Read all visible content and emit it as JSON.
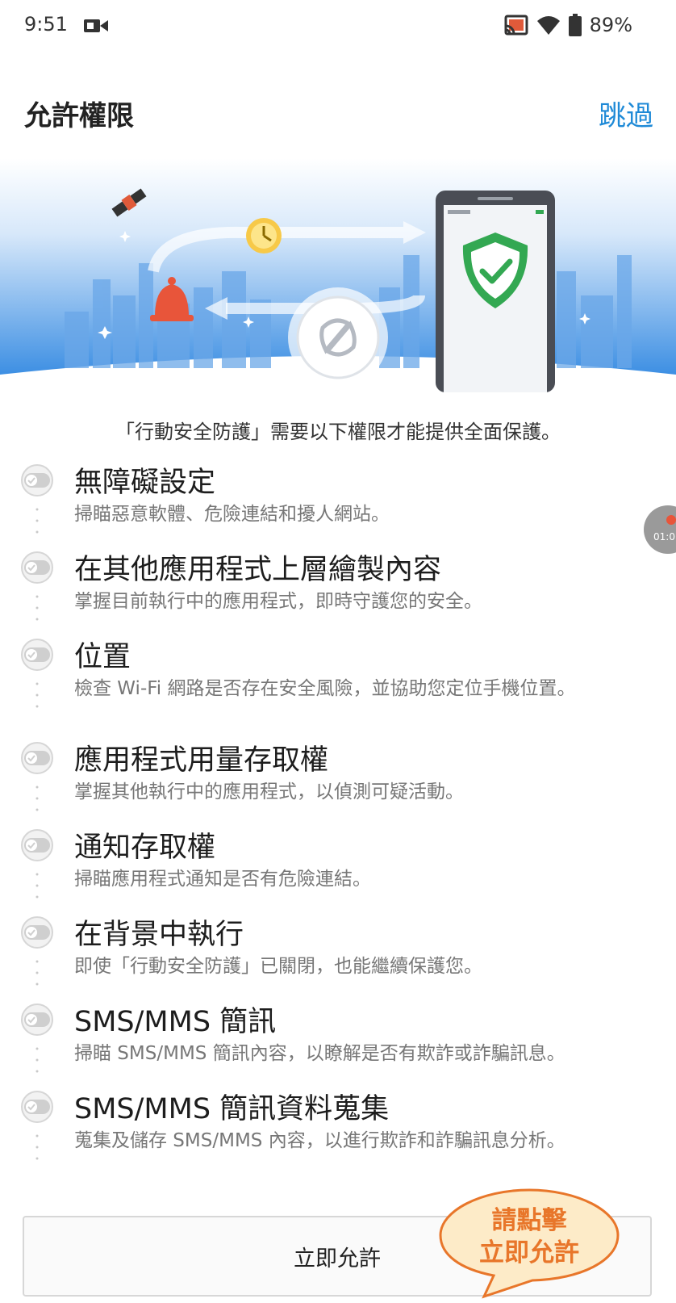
{
  "status_bar": {
    "time": "9:51",
    "battery": "89%"
  },
  "header": {
    "title": "允許權限",
    "skip_label": "跳過"
  },
  "subtitle": "「行動安全防護」需要以下權限才能提供全面保護。",
  "permissions": [
    {
      "name": "無障礙設定",
      "desc": "掃瞄惡意軟體、危險連結和擾人網站。"
    },
    {
      "name": "在其他應用程式上層繪製內容",
      "desc": "掌握目前執行中的應用程式，即時守護您的安全。"
    },
    {
      "name": "位置",
      "desc": "檢查 Wi-Fi 網路是否存在安全風險，並協助您定位手機位置。"
    },
    {
      "name": "應用程式用量存取權",
      "desc": "掌握其他執行中的應用程式，以偵測可疑活動。"
    },
    {
      "name": "通知存取權",
      "desc": "掃瞄應用程式通知是否有危險連結。"
    },
    {
      "name": "在背景中執行",
      "desc": "即使「行動安全防護」已關閉，也能繼續保護您。"
    },
    {
      "name": "SMS/MMS 簡訊",
      "desc": "掃瞄 SMS/MMS 簡訊內容，以瞭解是否有欺詐或詐騙訊息。"
    },
    {
      "name": "SMS/MMS 簡訊資料蒐集",
      "desc": "蒐集及儲存 SMS/MMS 內容，以進行欺詐和詐騙訊息分析。"
    }
  ],
  "allow_button": "立即允許",
  "callout": {
    "line1": "請點擊",
    "line2": "立即允許"
  },
  "recorder_badge": "01:0",
  "colors": {
    "accent": "#1f8ad7",
    "callout_orange": "#e8762a",
    "callout_fill": "#fdebc8",
    "shield_green": "#33a852",
    "sky_blue": "#4a9ae6"
  },
  "icons": {
    "camera": "video-camera-icon",
    "cast": "cast-icon",
    "wifi": "wifi-icon",
    "battery": "battery-icon",
    "toggle": "toggle-off-icon"
  }
}
